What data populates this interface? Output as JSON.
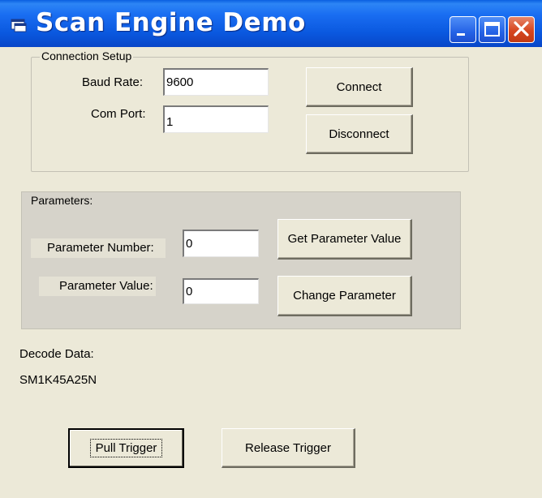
{
  "window": {
    "title": "Scan Engine Demo",
    "controls": {
      "minimize": "minimize",
      "maximize": "maximize",
      "close": "close"
    },
    "accent_color": "#0a58df",
    "close_color": "#d7461f"
  },
  "connection_setup": {
    "legend": "Connection Setup",
    "baud_rate_label": "Baud Rate:",
    "baud_rate_value": "9600",
    "com_port_label": "Com Port:",
    "com_port_value": "1",
    "connect_label": "Connect",
    "disconnect_label": "Disconnect"
  },
  "parameters": {
    "legend": "Parameters:",
    "number_label": "Parameter Number:",
    "number_value": "0",
    "value_label": "Parameter Value:",
    "value_value": "0",
    "get_label": "Get Parameter Value",
    "change_label": "Change Parameter"
  },
  "decode": {
    "label": "Decode Data:",
    "value": "SM1K45A25N"
  },
  "triggers": {
    "pull_label": "Pull Trigger",
    "release_label": "Release Trigger"
  }
}
